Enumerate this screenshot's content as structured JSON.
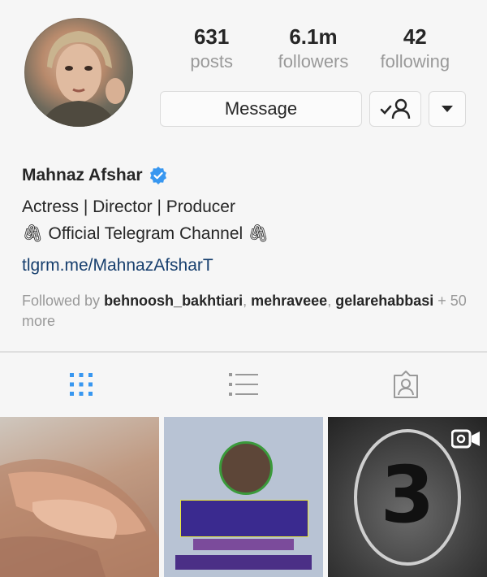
{
  "profile": {
    "stats": [
      {
        "value": "631",
        "label": "posts"
      },
      {
        "value": "6.1m",
        "label": "followers"
      },
      {
        "value": "42",
        "label": "following"
      }
    ],
    "actions": {
      "message_label": "Message",
      "follow_icon": "person-check-icon",
      "more_icon": "chevron-down-icon"
    },
    "name": "Mahnaz Afshar",
    "verified_icon": "verified-badge-icon",
    "bio_lines": [
      "Actress | Director | Producer",
      "🖇 Official Telegram Channel 🖇"
    ],
    "link": "tlgrm.me/MahnazAfsharT",
    "followed_by": {
      "prefix": "Followed by",
      "users": [
        "behnoosh_bakhtiari",
        "mehraveee",
        "gelarehabbasi"
      ],
      "suffix": "+ 50 more"
    }
  },
  "tabs": [
    {
      "name": "grid",
      "icon": "grid-icon",
      "active": true
    },
    {
      "name": "list",
      "icon": "list-icon",
      "active": false
    },
    {
      "name": "tagged",
      "icon": "tagged-person-icon",
      "active": false
    }
  ],
  "posts": [
    {
      "kind": "photo",
      "subject": "hands"
    },
    {
      "kind": "poster"
    },
    {
      "kind": "video",
      "number": "3",
      "badge_icon": "video-icon"
    }
  ],
  "colors": {
    "accent": "#3897f0",
    "link": "#173f6e",
    "muted": "#999999",
    "text": "#262626",
    "tab_active": "#3897f0",
    "tab_inactive": "#999999"
  }
}
